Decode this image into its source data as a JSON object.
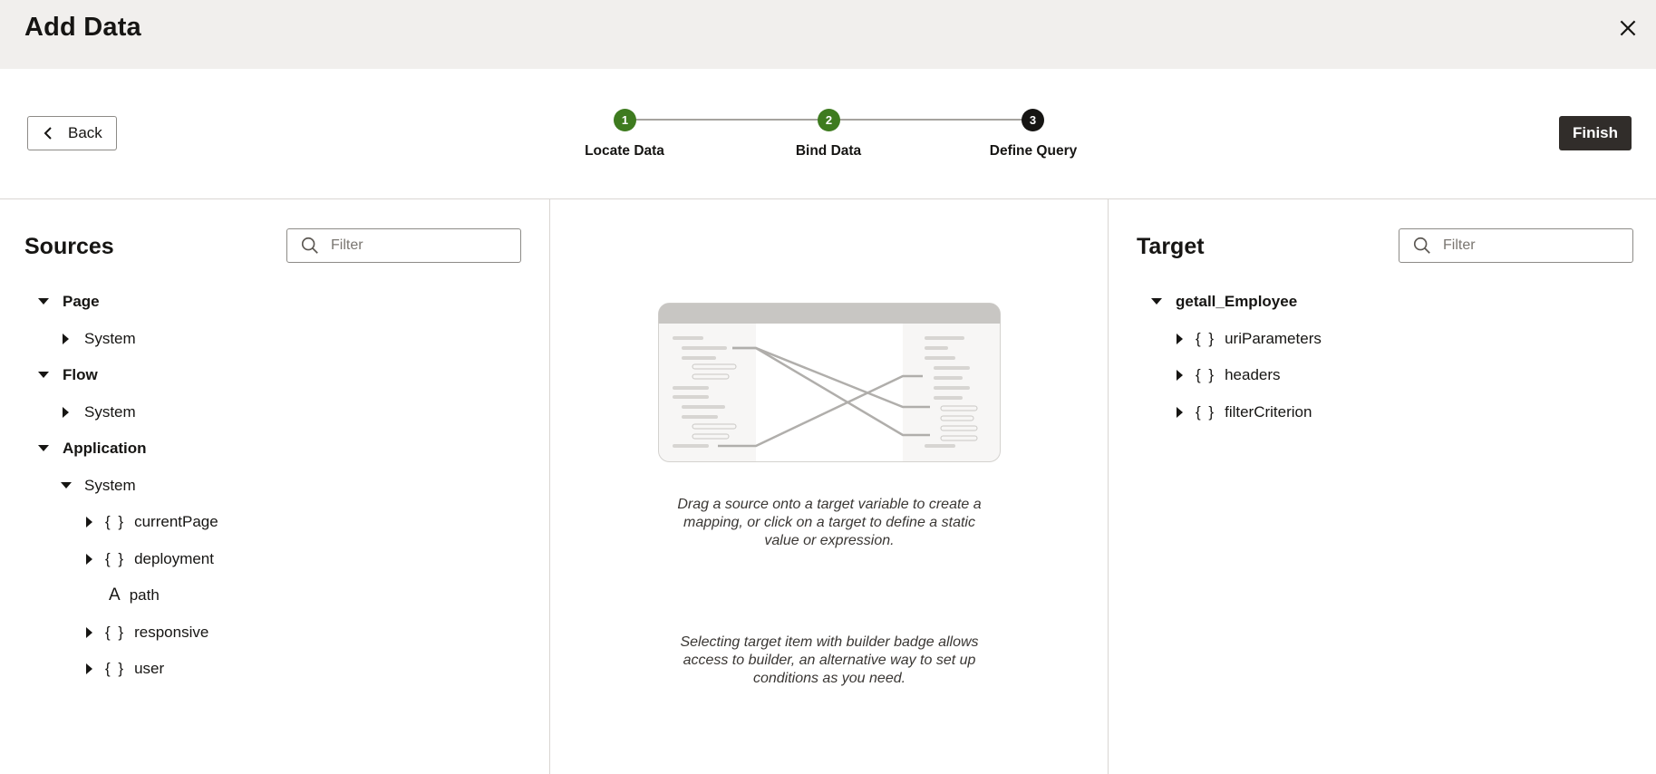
{
  "dialog": {
    "title": "Add Data"
  },
  "toolbar": {
    "back_label": "Back",
    "finish_label": "Finish"
  },
  "stepper": {
    "steps": [
      {
        "number": "1",
        "label": "Locate Data",
        "state": "done"
      },
      {
        "number": "2",
        "label": "Bind Data",
        "state": "done"
      },
      {
        "number": "3",
        "label": "Define Query",
        "state": "current"
      }
    ]
  },
  "sources": {
    "title": "Sources",
    "filter_placeholder": "Filter",
    "tree": [
      {
        "label": "Page",
        "expanded": true
      },
      {
        "label": "System",
        "expanded": false
      },
      {
        "label": "Flow",
        "expanded": true
      },
      {
        "label": "System",
        "expanded": false
      },
      {
        "label": "Application",
        "expanded": true
      },
      {
        "label": "System",
        "expanded": true
      },
      {
        "label": "currentPage",
        "type": "object"
      },
      {
        "label": "deployment",
        "type": "object"
      },
      {
        "label": "path",
        "type": "string"
      },
      {
        "label": "responsive",
        "type": "object"
      },
      {
        "label": "user",
        "type": "object"
      }
    ]
  },
  "center": {
    "hint_1": "Drag a source onto a target variable to create a mapping, or click on a target to define a static value or expression.",
    "hint_2": "Selecting target item with builder badge allows access to builder, an alternative way to set up conditions as you need."
  },
  "target": {
    "title": "Target",
    "filter_placeholder": "Filter",
    "tree": [
      {
        "label": "getall_Employee",
        "expanded": true
      },
      {
        "label": "uriParameters",
        "type": "object"
      },
      {
        "label": "headers",
        "type": "object"
      },
      {
        "label": "filterCriterion",
        "type": "object"
      }
    ]
  },
  "icons": {
    "object_glyph": "{ }",
    "string_glyph": "A"
  },
  "colors": {
    "step_done": "#3e7b1f",
    "step_current": "#161513",
    "finish_bg": "#312d2a",
    "header_bg": "#f1efed"
  }
}
